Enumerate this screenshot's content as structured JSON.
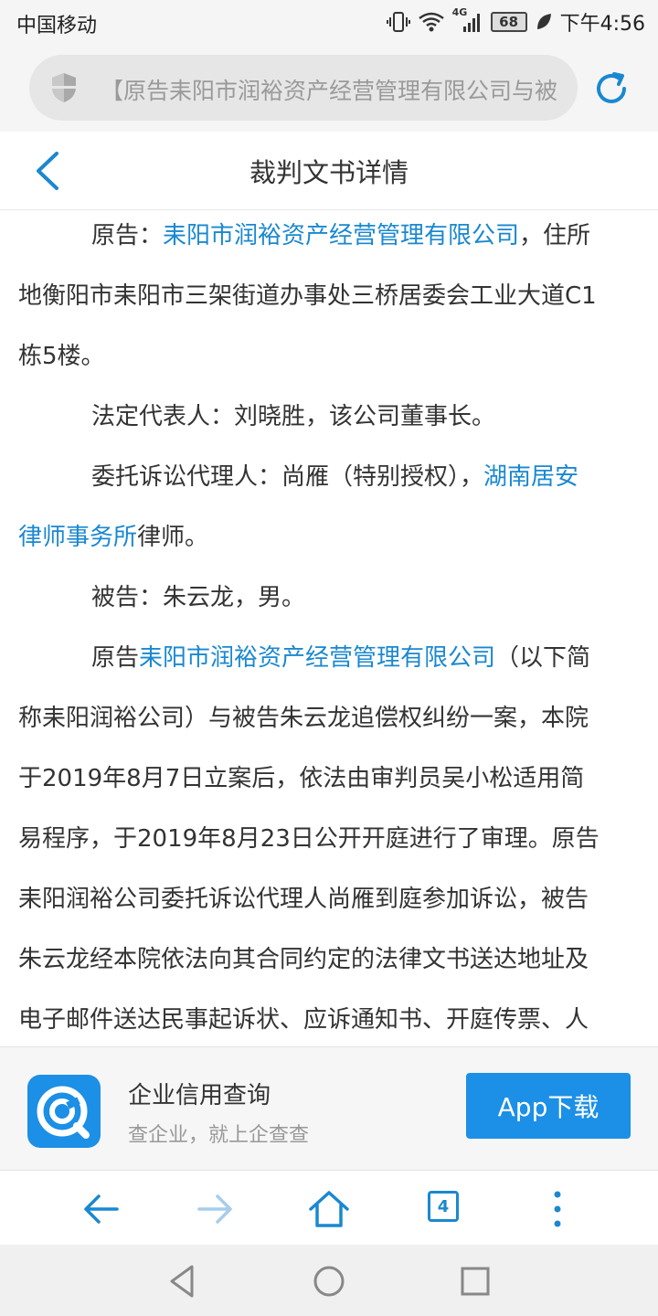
{
  "status_bar": {
    "carrier": "中国移动",
    "network": "4G",
    "battery": "68",
    "time": "下午4:56"
  },
  "address_bar": {
    "url_text": "【原告耒阳市润裕资产经营管理有限公司与被"
  },
  "header": {
    "title": "裁判文书详情"
  },
  "document": {
    "lines": [
      {
        "indent": true,
        "segments": [
          {
            "text": "原告："
          },
          {
            "text": "耒阳市润裕资产经营管理有限公司",
            "link": true
          },
          {
            "text": "，住所"
          }
        ]
      },
      {
        "indent": false,
        "segments": [
          {
            "text": "地衡阳市耒阳市三架街道办事处三桥居委会工业大道C1"
          }
        ]
      },
      {
        "indent": false,
        "segments": [
          {
            "text": "栋5楼。"
          }
        ]
      },
      {
        "indent": true,
        "segments": [
          {
            "text": "法定代表人：刘晓胜，该公司董事长。"
          }
        ]
      },
      {
        "indent": true,
        "segments": [
          {
            "text": "委托诉讼代理人：尚雁（特别授权），"
          },
          {
            "text": "湖南居安",
            "link": true
          }
        ]
      },
      {
        "indent": false,
        "segments": [
          {
            "text": "律师事务所",
            "link": true
          },
          {
            "text": "律师。"
          }
        ]
      },
      {
        "indent": true,
        "segments": [
          {
            "text": "被告：朱云龙，男。"
          }
        ]
      },
      {
        "indent": true,
        "segments": [
          {
            "text": "原告"
          },
          {
            "text": "耒阳市润裕资产经营管理有限公司",
            "link": true
          },
          {
            "text": "（以下简"
          }
        ]
      },
      {
        "indent": false,
        "segments": [
          {
            "text": "称耒阳润裕公司）与被告朱云龙追偿权纠纷一案，本院"
          }
        ]
      },
      {
        "indent": false,
        "segments": [
          {
            "text": "于2019年8月7日立案后，依法由审判员吴小松适用简"
          }
        ]
      },
      {
        "indent": false,
        "segments": [
          {
            "text": "易程序，于2019年8月23日公开开庭进行了审理。原告"
          }
        ]
      },
      {
        "indent": false,
        "segments": [
          {
            "text": "耒阳润裕公司委托诉讼代理人尚雁到庭参加诉讼，被告"
          }
        ]
      },
      {
        "indent": false,
        "segments": [
          {
            "text": "朱云龙经本院依法向其合同约定的法律文书送达地址及"
          }
        ]
      },
      {
        "indent": false,
        "segments": [
          {
            "text": "电子邮件送达民事起诉状、应诉通知书、开庭传票、人"
          }
        ]
      }
    ]
  },
  "promo": {
    "title": "企业信用查询",
    "subtitle": "查企业，就上企查查",
    "button": "App下载"
  },
  "toolbar": {
    "tab_count": "4"
  },
  "colors": {
    "accent": "#1a88d0",
    "link": "#1a88d0",
    "promo_blue": "#1c8fe6"
  }
}
